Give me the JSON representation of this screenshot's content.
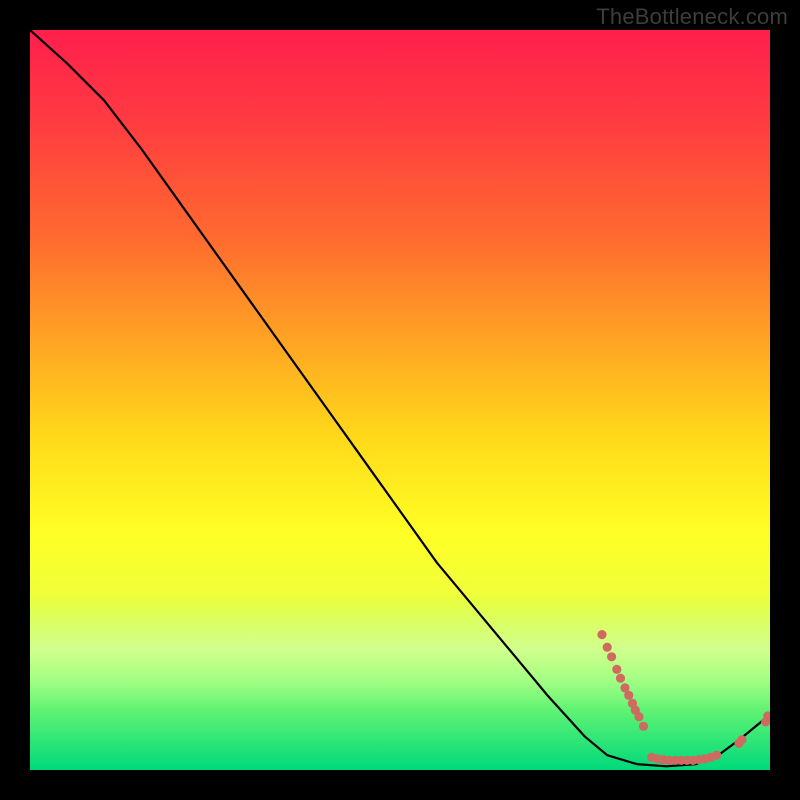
{
  "watermark": "TheBottleneck.com",
  "colors": {
    "bg": "#000000",
    "line": "#000000",
    "marker": "#cf6a61",
    "gradient_top": "#ff1f4b",
    "gradient_bottom": "#00d97a"
  },
  "chart_data": {
    "type": "line",
    "title": "",
    "xlabel": "",
    "ylabel": "",
    "xlim": [
      0,
      100
    ],
    "ylim": [
      0,
      100
    ],
    "grid": false,
    "legend": false,
    "series": [
      {
        "name": "curve",
        "x": [
          0,
          5,
          10,
          15,
          20,
          25,
          30,
          35,
          40,
          45,
          50,
          55,
          60,
          65,
          70,
          75,
          78,
          82,
          86,
          90,
          93,
          96,
          100
        ],
        "y": [
          100,
          95.5,
          90.5,
          84,
          77,
          70,
          63,
          56,
          49,
          42,
          35,
          28,
          22,
          16,
          10,
          4.5,
          2,
          0.8,
          0.5,
          0.8,
          2,
          4.2,
          7.5
        ]
      }
    ],
    "markers": [
      {
        "x": 77.3,
        "y": 18.3
      },
      {
        "x": 78.0,
        "y": 16.6
      },
      {
        "x": 78.6,
        "y": 15.3
      },
      {
        "x": 79.3,
        "y": 13.6
      },
      {
        "x": 79.8,
        "y": 12.4
      },
      {
        "x": 80.4,
        "y": 11.1
      },
      {
        "x": 80.9,
        "y": 10.1
      },
      {
        "x": 81.4,
        "y": 9.0
      },
      {
        "x": 81.8,
        "y": 8.1
      },
      {
        "x": 82.3,
        "y": 7.2
      },
      {
        "x": 82.9,
        "y": 5.9
      },
      {
        "x": 84.0,
        "y": 1.7
      },
      {
        "x": 84.8,
        "y": 1.5
      },
      {
        "x": 85.6,
        "y": 1.4
      },
      {
        "x": 86.4,
        "y": 1.3
      },
      {
        "x": 87.2,
        "y": 1.3
      },
      {
        "x": 88.0,
        "y": 1.3
      },
      {
        "x": 88.8,
        "y": 1.3
      },
      {
        "x": 89.6,
        "y": 1.3
      },
      {
        "x": 90.4,
        "y": 1.4
      },
      {
        "x": 91.2,
        "y": 1.5
      },
      {
        "x": 92.0,
        "y": 1.7
      },
      {
        "x": 92.8,
        "y": 2.0
      },
      {
        "x": 95.8,
        "y": 3.6
      },
      {
        "x": 96.2,
        "y": 4.1
      },
      {
        "x": 99.4,
        "y": 6.5
      },
      {
        "x": 99.7,
        "y": 7.3
      }
    ]
  }
}
